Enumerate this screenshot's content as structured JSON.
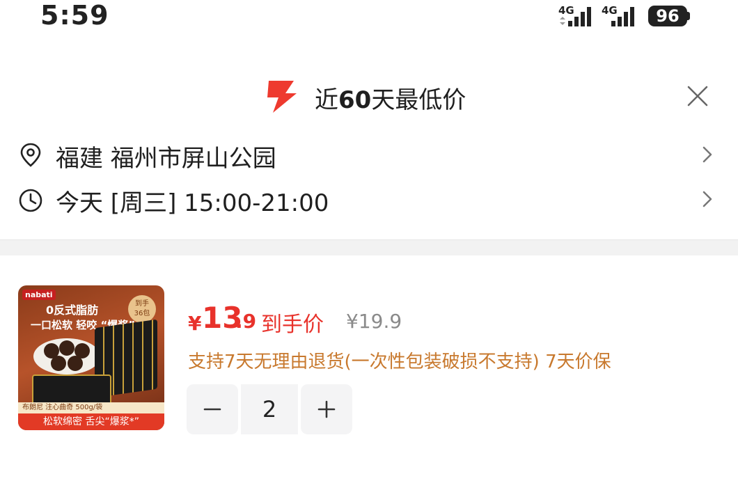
{
  "status_bar": {
    "time": "5:59",
    "network_1": "4G",
    "network_2": "4G",
    "battery": "96"
  },
  "header": {
    "title_prefix": "近",
    "title_number": "60",
    "title_suffix": "天最低价",
    "accent_color": "#ee3a2f",
    "icon": "lightning-icon"
  },
  "address": {
    "text": "福建  福州市屏山公园",
    "icon": "location-pin-icon"
  },
  "delivery_time": {
    "text": "今天 [周三] 15:00-21:00",
    "icon": "clock-icon"
  },
  "product": {
    "image_text": {
      "brand": "nabati",
      "line1": "0反式脂肪",
      "line2": "一口松软 轻咬 “爆浆”",
      "badge_top": "到手",
      "badge_bottom": "36包",
      "info": "布朗尼 注心曲奇 500g/袋",
      "footer": "松软绵密 舌尖“爆浆*”"
    },
    "price_currency": "¥",
    "price_integer": "13",
    "price_decimal": ".9",
    "price_label": "到手价",
    "original_price": "¥19.9",
    "service_text": "支持7天无理由退货(一次性包装破损不支持) 7天价保",
    "quantity": "2",
    "price_color": "#e8322b",
    "service_color": "#c8792e"
  }
}
